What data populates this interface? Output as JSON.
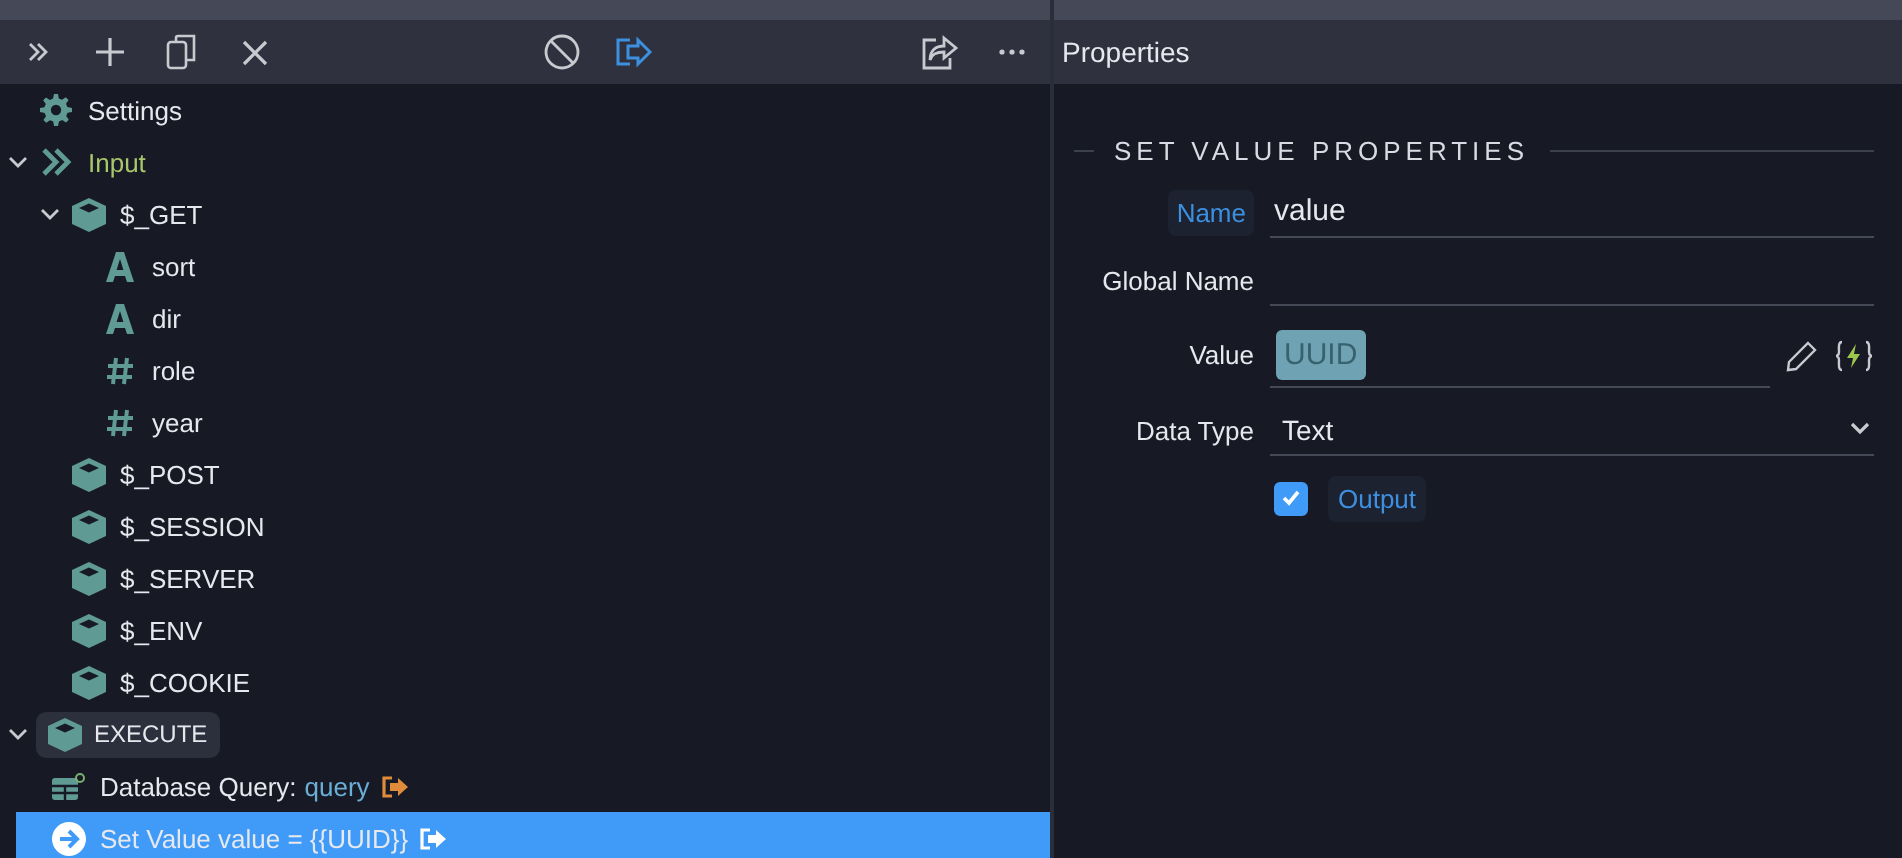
{
  "toolbar": {
    "buttons": [
      {
        "kind": "expand"
      },
      {
        "kind": "add"
      },
      {
        "kind": "copy"
      },
      {
        "kind": "delete"
      },
      {
        "kind": "disable"
      },
      {
        "kind": "output",
        "active": true
      },
      {
        "kind": "share"
      },
      {
        "kind": "more"
      }
    ]
  },
  "steps": [
    {
      "kind": "settings",
      "label": "Settings",
      "selected": false
    },
    {
      "kind": "input",
      "label": "Input",
      "selected": false,
      "expanded": true,
      "children": [
        {
          "kind": "group",
          "label": "$_GET",
          "selected": false,
          "expanded": true,
          "children": [
            {
              "kind": "text",
              "label": "sort",
              "selected": false
            },
            {
              "kind": "text",
              "label": "dir",
              "selected": false
            },
            {
              "kind": "number",
              "label": "role",
              "selected": false
            },
            {
              "kind": "number",
              "label": "year",
              "selected": false
            }
          ]
        },
        {
          "kind": "group",
          "label": "$_POST",
          "selected": false
        },
        {
          "kind": "group",
          "label": "$_SESSION",
          "selected": false
        },
        {
          "kind": "group",
          "label": "$_SERVER",
          "selected": false
        },
        {
          "kind": "group",
          "label": "$_ENV",
          "selected": false
        },
        {
          "kind": "group",
          "label": "$_COOKIE",
          "selected": false
        }
      ]
    },
    {
      "kind": "execute",
      "label": "EXECUTE",
      "selected": false,
      "expanded": true,
      "children": [
        {
          "kind": "query",
          "label": "Database Query:",
          "value": "query",
          "output": true,
          "selected": false
        },
        {
          "kind": "setvalue",
          "label": "Set Value value = {{UUID}}",
          "output": true,
          "selected": true
        }
      ]
    }
  ],
  "properties": {
    "title": "Properties",
    "section": "SET VALUE PROPERTIES",
    "fields": [
      {
        "kind": "text",
        "label": "Name",
        "value": "value",
        "highlighted": true
      },
      {
        "kind": "text",
        "label": "Global Name"
      },
      {
        "kind": "token",
        "label": "Value",
        "value": "UUID"
      },
      {
        "kind": "select",
        "label": "Data Type",
        "value": "Text"
      },
      {
        "kind": "checkbox",
        "label": "Output",
        "checked": true
      }
    ]
  }
}
